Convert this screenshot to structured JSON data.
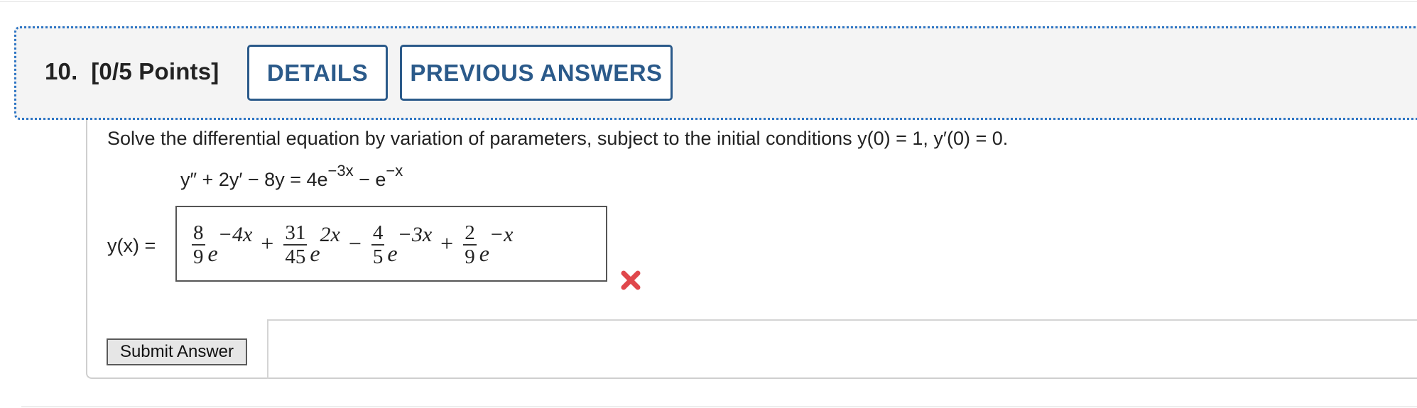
{
  "question": {
    "number": "10.",
    "points": "[0/5 Points]",
    "details_label": "DETAILS",
    "previous_answers_label": "PREVIOUS ANSWERS"
  },
  "prompt": {
    "text": "Solve the differential equation by variation of parameters, subject to the initial conditions ",
    "conditions": "y(0) = 1, y′(0) = 0."
  },
  "equation": {
    "lhs": "y″ + 2y′ − 8y = 4e",
    "exp1": "−3x",
    "mid": " − e",
    "exp2": "−x"
  },
  "answer": {
    "label": "y(x) =",
    "terms": [
      {
        "sign": "",
        "num": "8",
        "den": "9",
        "base": "e",
        "exp": "−4x"
      },
      {
        "sign": "+",
        "num": "31",
        "den": "45",
        "base": "e",
        "exp": "2x"
      },
      {
        "sign": "−",
        "num": "4",
        "den": "5",
        "base": "e",
        "exp": "−3x"
      },
      {
        "sign": "+",
        "num": "2",
        "den": "9",
        "base": "e",
        "exp": "−x"
      }
    ],
    "status_icon": "incorrect-x-icon",
    "status_color": "#e0474c"
  },
  "submit_label": "Submit Answer",
  "colors": {
    "accent": "#2b5a8a",
    "focus_dotted": "#2e75c4"
  }
}
